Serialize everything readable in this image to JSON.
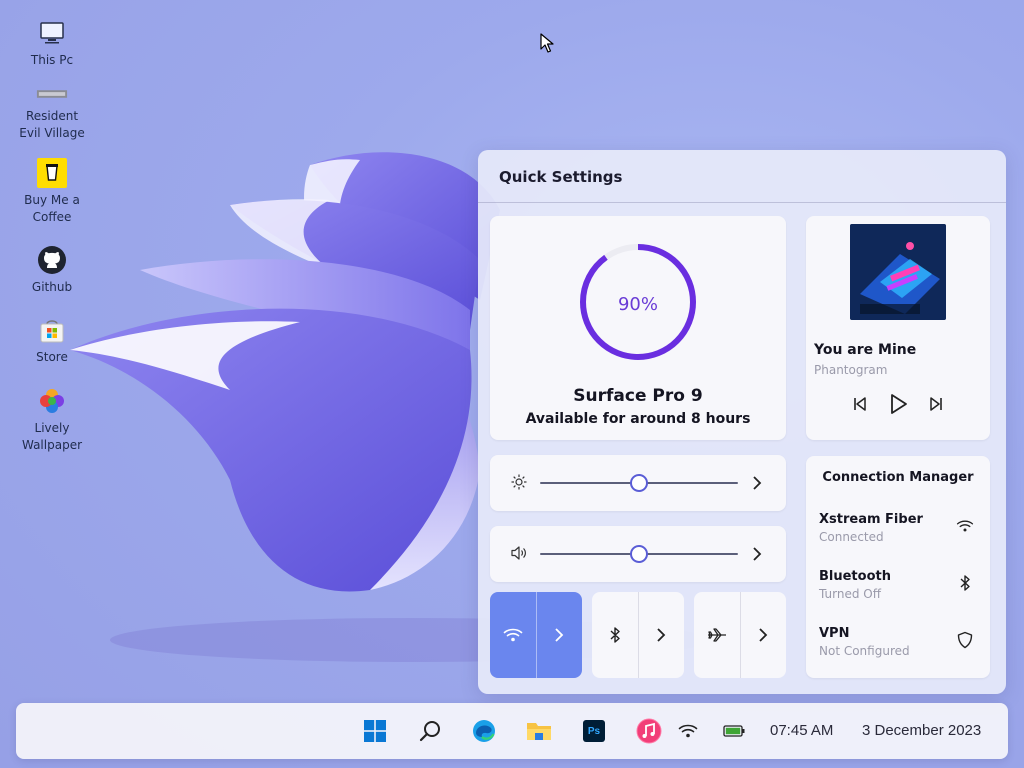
{
  "desktop": {
    "icons": [
      {
        "label_line1": "This Pc",
        "label_line2": "",
        "icon": "computer-icon"
      },
      {
        "label_line1": "Resident",
        "label_line2": "Evil Village",
        "icon": "game-logo-icon"
      },
      {
        "label_line1": "Buy Me a",
        "label_line2": "Coffee",
        "icon": "coffee-cup-icon"
      },
      {
        "label_line1": "Github",
        "label_line2": "",
        "icon": "github-icon"
      },
      {
        "label_line1": "Store",
        "label_line2": "",
        "icon": "store-bag-icon"
      },
      {
        "label_line1": "Lively",
        "label_line2": "Wallpaper",
        "icon": "flower-logo-icon"
      }
    ]
  },
  "quick_settings": {
    "title": "Quick Settings",
    "battery": {
      "percent_label": "90%",
      "percent_value": 0.9,
      "device_name": "Surface Pro 9",
      "availability": "Available for around 8 hours",
      "ring_color": "#6a2ee0"
    },
    "media": {
      "song": "You are Mine",
      "artist": "Phantogram"
    },
    "brightness": {
      "icon": "sun-icon",
      "level": 0.5
    },
    "volume": {
      "icon": "speaker-icon",
      "level": 0.5
    },
    "toggles": [
      {
        "name": "wifi",
        "icon": "wifi-icon",
        "on": true
      },
      {
        "name": "bluetooth",
        "icon": "bluetooth-icon",
        "on": false
      },
      {
        "name": "airplane",
        "icon": "airplane-icon",
        "on": false
      }
    ],
    "connection_manager": {
      "title": "Connection Manager",
      "items": [
        {
          "name": "Xstream Fiber",
          "status": "Connected",
          "icon": "wifi-icon"
        },
        {
          "name": "Bluetooth",
          "status": "Turned Off",
          "icon": "bluetooth-icon"
        },
        {
          "name": "VPN",
          "status": "Not Configured",
          "icon": "shield-icon"
        }
      ]
    }
  },
  "taskbar": {
    "apps": [
      "windows-start-icon",
      "search-icon",
      "edge-icon",
      "file-explorer-icon",
      "photoshop-icon",
      "music-icon"
    ],
    "photoshop_label": "Ps",
    "time": "07:45 AM",
    "date": "3 December 2023"
  },
  "colors": {
    "accent": "#6a86ee",
    "battery_ring": "#6a2ee0",
    "slider_thumb": "#5a5dd6"
  }
}
